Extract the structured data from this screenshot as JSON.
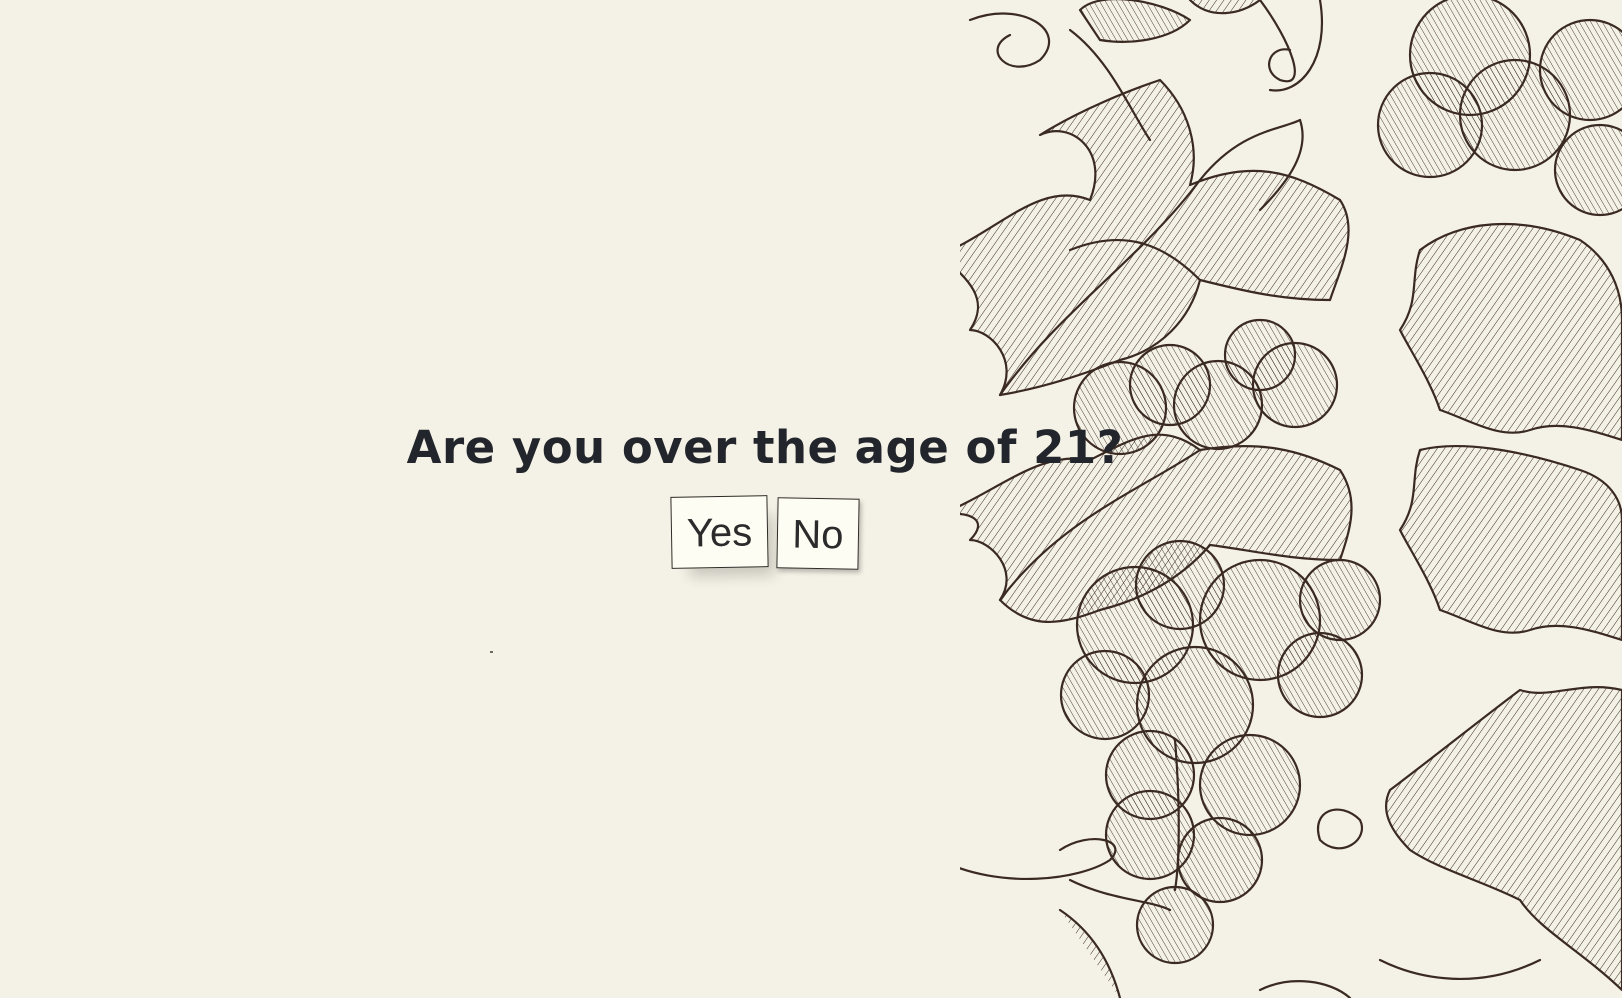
{
  "age_gate": {
    "question": "Are you over the age of 21?",
    "yes_label": "Yes",
    "no_label": "No"
  },
  "decoration": {
    "illustration": "hand-drawn grape vine with grape clusters and leaves",
    "ink_color": "#3a2a22",
    "background_color": "#f4f2e6"
  }
}
